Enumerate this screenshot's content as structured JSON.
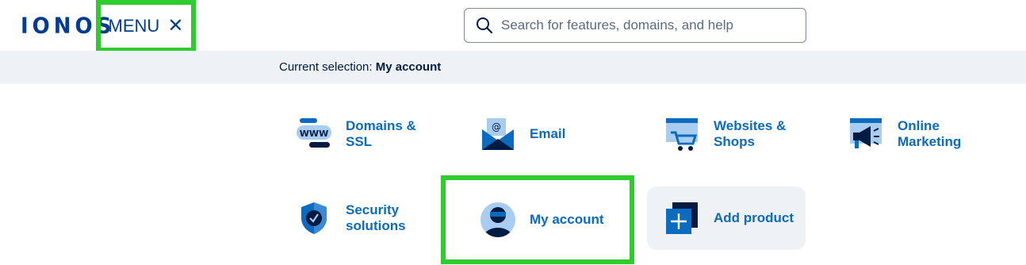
{
  "header": {
    "logo": "IONOS",
    "menu_label": "MENU",
    "search_placeholder": "Search for features, domains, and help"
  },
  "selection": {
    "prefix": "Current selection:",
    "value": "My account"
  },
  "tiles": [
    {
      "label_line1": "Domains &",
      "label_line2": "SSL"
    },
    {
      "label_line1": "Email",
      "label_line2": ""
    },
    {
      "label_line1": "Websites &",
      "label_line2": "Shops"
    },
    {
      "label_line1": "Online",
      "label_line2": "Marketing"
    },
    {
      "label_line1": "Security",
      "label_line2": "solutions"
    },
    {
      "label_line1": "My account",
      "label_line2": ""
    },
    {
      "label_line1": "Add product",
      "label_line2": ""
    }
  ],
  "colors": {
    "brand": "#003d8f",
    "link": "#0b6bbf",
    "highlight": "#2ecc2e",
    "bar_bg": "#eef2f6"
  }
}
